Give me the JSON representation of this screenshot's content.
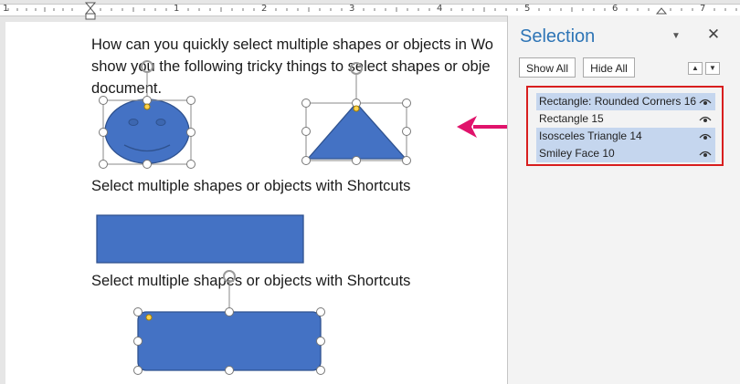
{
  "ruler": {
    "numbers": [
      "1",
      "1",
      "2",
      "3",
      "4",
      "5",
      "6",
      "7"
    ]
  },
  "document": {
    "paragraph_lines": [
      "How can you quickly select multiple shapes or objects in Wo",
      "show you the following tricky things to select shapes or obje",
      "document."
    ],
    "heading_1": "Select multiple shapes or objects with Shortcuts",
    "heading_2": "Select multiple shapes or objects with Shortcuts"
  },
  "selection_pane": {
    "title": "Selection",
    "show_all_label": "Show All",
    "hide_all_label": "Hide All",
    "items": [
      {
        "label": "Rectangle: Rounded Corners 16",
        "selected": true,
        "icon": "eye-icon"
      },
      {
        "label": "Rectangle 15",
        "selected": false,
        "icon": "eye-icon"
      },
      {
        "label": "Isosceles Triangle 14",
        "selected": true,
        "icon": "eye-icon"
      },
      {
        "label": "Smiley Face 10",
        "selected": true,
        "icon": "eye-icon"
      }
    ]
  },
  "colors": {
    "shape_fill": "#4472c4",
    "shape_stroke": "#2f528f",
    "highlight_box": "#d81e1e",
    "arrow": "#e0136b",
    "pane_title": "#2e75b6",
    "selected_row": "#c5d6ee"
  }
}
